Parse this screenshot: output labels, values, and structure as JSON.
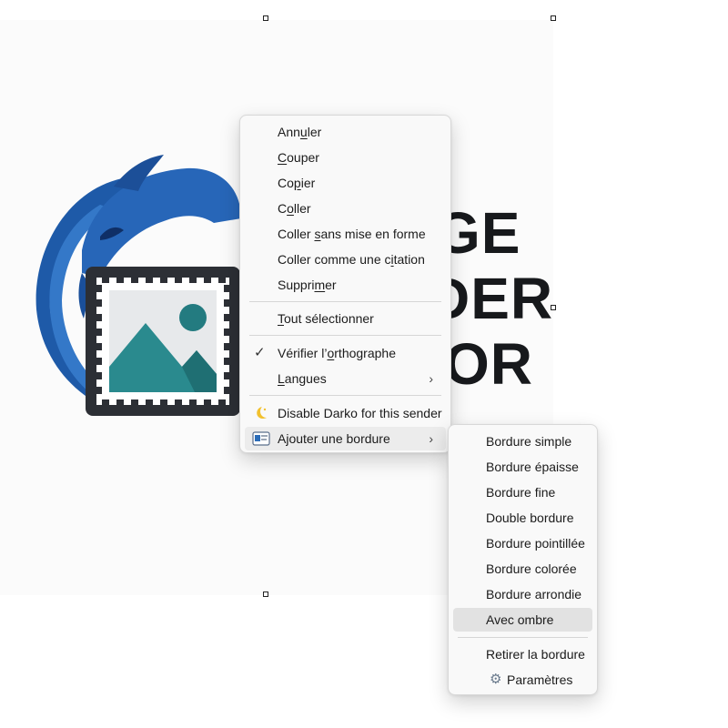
{
  "background_text": {
    "line1": "GE",
    "line2": "DER",
    "line3": "OR"
  },
  "context_menu": {
    "items": {
      "undo": "Annuler",
      "cut": "Couper",
      "copy": "Copier",
      "paste": "Coller",
      "paste_plain": "Coller sans mise en forme",
      "paste_quote": "Coller comme une citation",
      "delete": "Supprimer",
      "select_all": "Tout sélectionner",
      "spellcheck": "Vérifier l’orthographe",
      "languages": "Langues",
      "disable_darko": "Disable Darko for this sender",
      "add_border": "Ajouter une bordure"
    },
    "icons": {
      "spellcheck": "check-icon",
      "languages": "chevron-right-icon",
      "disable_darko": "moon-icon",
      "add_border": "border-addon-icon"
    }
  },
  "submenu": {
    "items": [
      "Bordure simple",
      "Bordure épaisse",
      "Bordure fine",
      "Double bordure",
      "Bordure pointillée",
      "Bordure colorée",
      "Bordure arrondie",
      "Avec ombre"
    ],
    "highlighted": "Avec ombre",
    "remove": "Retirer la bordure",
    "settings": "Paramètres",
    "settings_icon": "gear-icon"
  },
  "colors": {
    "logo_blue": "#1f5fb0",
    "stamp_frame": "#2c2f35",
    "image_teal": "#2a8a8e",
    "highlight": "#e2e2e2"
  }
}
